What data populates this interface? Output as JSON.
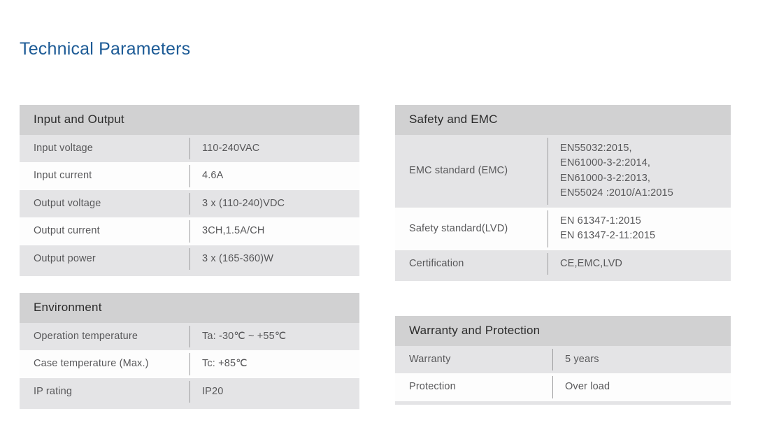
{
  "page": {
    "title": "Technical Parameters",
    "title_color": "#1d5b96",
    "header_bg": "#d1d1d2",
    "row_shaded_bg": "#e4e4e6",
    "row_plain_bg": "#fdfdfd",
    "text_color": "#58585a",
    "divider_color": "#9a9a9c"
  },
  "tables": {
    "input_output": {
      "header": "Input and Output",
      "rows": [
        {
          "label": "Input voltage",
          "value": "110-240VAC"
        },
        {
          "label": "Input current",
          "value": "4.6A"
        },
        {
          "label": "Output voltage",
          "value": "3 x (110-240)VDC"
        },
        {
          "label": "Output current",
          "value": "3CH,1.5A/CH"
        },
        {
          "label": "Output power",
          "value": "3 x (165-360)W"
        }
      ]
    },
    "environment": {
      "header": "Environment",
      "rows": [
        {
          "label": "Operation temperature",
          "value": "Ta: -30℃ ~ +55℃"
        },
        {
          "label": "Case temperature (Max.)",
          "value": "Tc: +85℃"
        },
        {
          "label": "IP rating",
          "value": "IP20"
        }
      ]
    },
    "safety_emc": {
      "header": "Safety and EMC",
      "rows": [
        {
          "label": "EMC standard (EMC)",
          "value_lines": [
            "EN55032:2015,",
            "EN61000-3-2:2014,",
            "EN61000-3-2:2013,",
            "EN55024 :2010/A1:2015"
          ]
        },
        {
          "label": "Safety standard(LVD)",
          "value_lines": [
            "EN 61347-1:2015",
            "EN 61347-2-11:2015"
          ]
        },
        {
          "label": "Certification",
          "value_lines": [
            "CE,EMC,LVD"
          ]
        }
      ]
    },
    "warranty_protection": {
      "header": "Warranty and Protection",
      "rows": [
        {
          "label": "Warranty",
          "value": "5 years"
        },
        {
          "label": "Protection",
          "value": "Over load"
        }
      ]
    }
  }
}
